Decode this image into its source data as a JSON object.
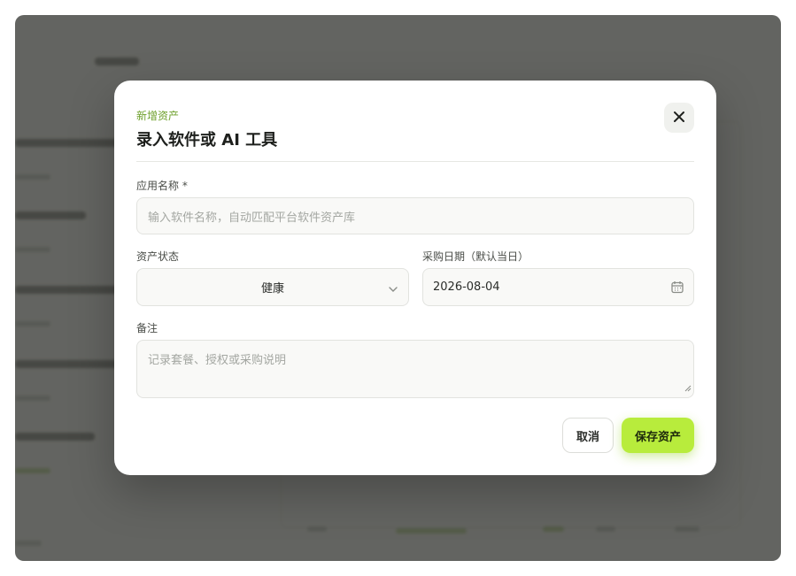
{
  "modal": {
    "eyebrow": "新增资产",
    "title": "录入软件或 AI 工具",
    "close_icon": "close-icon"
  },
  "form": {
    "app_name_label": "应用名称 *",
    "app_name_placeholder": "输入软件名称，自动匹配平台软件资产库",
    "status_label": "资产状态",
    "status_value": "健康",
    "date_label": "采购日期（默认当日）",
    "date_value": "2026-08-04",
    "notes_label": "备注",
    "notes_placeholder": "记录套餐、授权或采购说明"
  },
  "actions": {
    "cancel_label": "取消",
    "save_label": "保存资产"
  },
  "colors": {
    "accent": "#b8ec3c",
    "eyebrow": "#6ea02b",
    "overlay": "#30322e"
  }
}
